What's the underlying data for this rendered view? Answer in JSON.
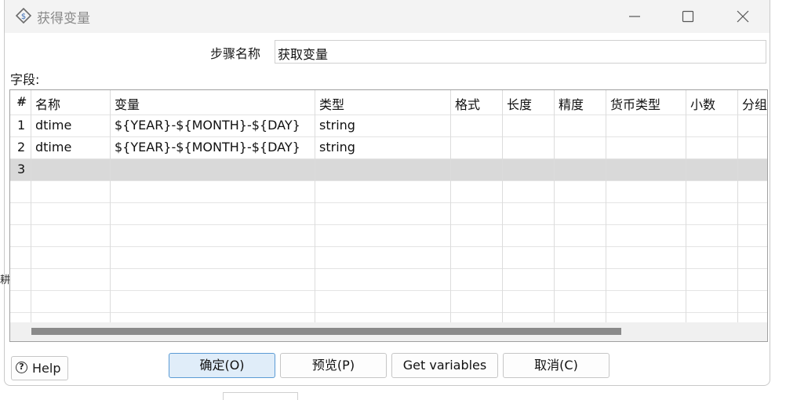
{
  "window": {
    "title": "获得变量",
    "icon": "pentaho-variable-icon"
  },
  "form": {
    "step_name_label": "步骤名称",
    "step_name_value": "获取变量",
    "fields_label": "字段:"
  },
  "table": {
    "columns": [
      "#",
      "名称",
      "变量",
      "类型",
      "格式",
      "长度",
      "精度",
      "货币类型",
      "小数",
      "分组"
    ],
    "rows": [
      {
        "num": "1",
        "name": "dtime",
        "variable": "${YEAR}-${MONTH}-${DAY}",
        "type": "string"
      },
      {
        "num": "2",
        "name": "dtime",
        "variable": "${YEAR}-${MONTH}-${DAY}",
        "type": "string"
      },
      {
        "num": "3",
        "name": "",
        "variable": "",
        "type": ""
      }
    ],
    "selected_row": "3"
  },
  "buttons": {
    "help": "Help",
    "ok": "确定(O)",
    "preview": "预览(P)",
    "get_variables": "Get variables",
    "cancel": "取消(C)"
  },
  "colors": {
    "primary_button_bg": "#e0edf9",
    "primary_button_border": "#5b9bd5",
    "selected_row": "#d9d9d9",
    "titlebar": "#f3f3f3"
  }
}
